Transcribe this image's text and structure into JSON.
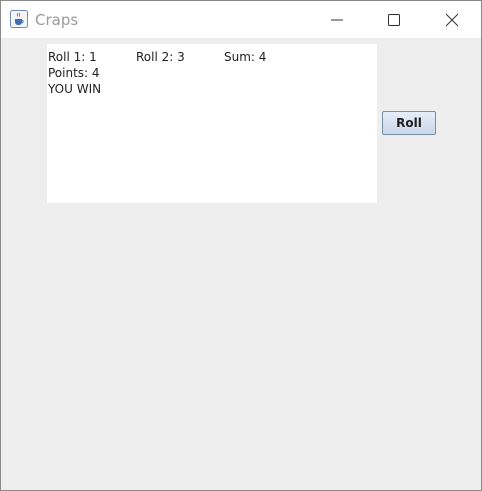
{
  "window": {
    "title": "Craps",
    "icon": "java-cup-icon"
  },
  "output": {
    "roll1": "Roll 1: 1",
    "roll2": "Roll 2: 3",
    "sum": "Sum: 4",
    "points": "Points: 4",
    "result": "YOU WIN"
  },
  "controls": {
    "roll_label": "Roll"
  },
  "colors": {
    "window_bg": "#eeeeee",
    "titlebar_bg": "#ffffff",
    "title_text": "#9a9a9a",
    "button_border": "#7a8ea8"
  }
}
